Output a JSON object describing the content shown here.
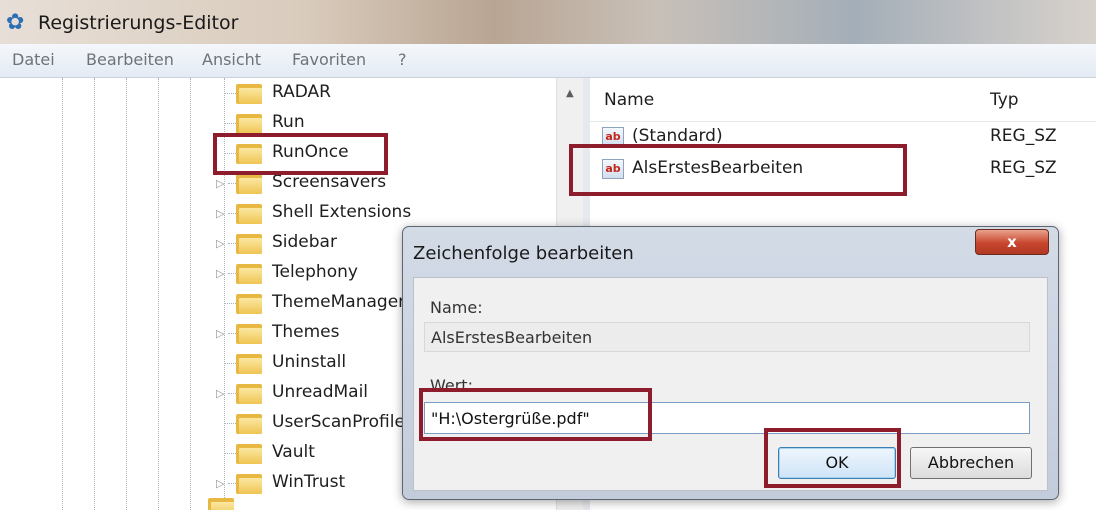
{
  "window": {
    "title": "Registrierungs-Editor",
    "icon": "registry-editor-icon"
  },
  "menu": [
    "Datei",
    "Bearbeiten",
    "Ansicht",
    "Favoriten",
    "?"
  ],
  "tree": {
    "items": [
      {
        "label": "RADAR",
        "expandable": false
      },
      {
        "label": "Run",
        "expandable": false
      },
      {
        "label": "RunOnce",
        "expandable": false,
        "selected": true
      },
      {
        "label": "Screensavers",
        "expandable": true
      },
      {
        "label": "Shell Extensions",
        "expandable": true
      },
      {
        "label": "Sidebar",
        "expandable": true
      },
      {
        "label": "Telephony",
        "expandable": true
      },
      {
        "label": "ThemeManager",
        "expandable": false
      },
      {
        "label": "Themes",
        "expandable": true
      },
      {
        "label": "Uninstall",
        "expandable": false
      },
      {
        "label": "UnreadMail",
        "expandable": true
      },
      {
        "label": "UserScanProfile",
        "expandable": false
      },
      {
        "label": "Vault",
        "expandable": false
      },
      {
        "label": "WinTrust",
        "expandable": true
      }
    ]
  },
  "list": {
    "columns": {
      "name": "Name",
      "type": "Typ"
    },
    "rows": [
      {
        "name": "(Standard)",
        "type": "REG_SZ",
        "icon": "ab"
      },
      {
        "name": "AlsErstesBearbeiten",
        "type": "REG_SZ",
        "icon": "ab"
      }
    ]
  },
  "dialog": {
    "title": "Zeichenfolge bearbeiten",
    "close_label": "x",
    "name_label": "Name:",
    "name_value": "AlsErstesBearbeiten",
    "value_label": "Wert:",
    "value": "\"H:\\Ostergrüße.pdf\"",
    "ok_label": "OK",
    "cancel_label": "Abbrechen"
  },
  "colors": {
    "highlight": "#8d1d2c",
    "folder": "#efc453",
    "dialog_close": "#c8452d"
  }
}
